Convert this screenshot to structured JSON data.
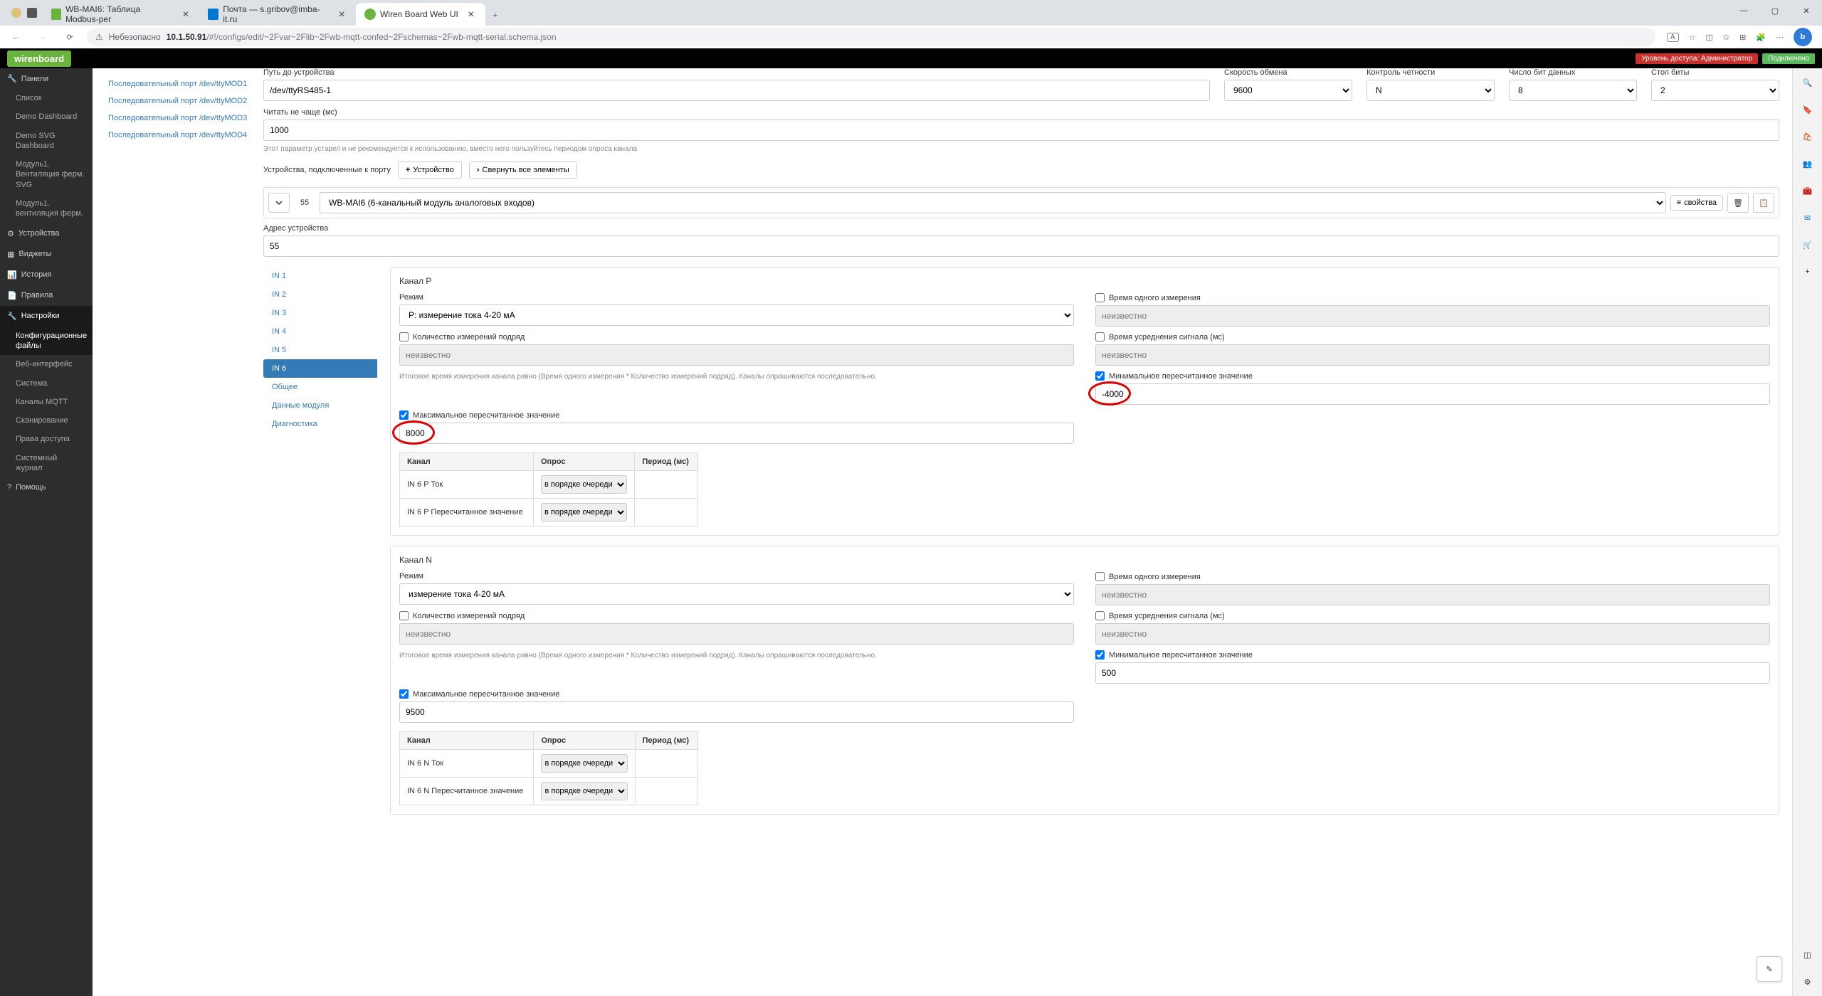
{
  "browser": {
    "tabs": [
      {
        "title": "WB-MAI6: Таблица Modbus-рег",
        "favicon": "#6bb33f"
      },
      {
        "title": "Почта — s.gribov@imba-it.ru",
        "favicon": "#0078d4"
      },
      {
        "title": "Wiren Board Web UI",
        "favicon": "#6bb33f",
        "active": true
      }
    ],
    "insecure_label": "Небезопасно",
    "url_host": "10.1.50.91",
    "url_path": "/#!/configs/edit/~2Fvar~2Flib~2Fwb-mqtt-confed~2Fschemas~2Fwb-mqtt-serial.schema.json",
    "reader_badge": "A"
  },
  "header": {
    "logo": "wirenboard",
    "access_label": "Уровень доступа: Администратор",
    "conn_label": "Подключено"
  },
  "nav": {
    "panels": "Панели",
    "panels_items": [
      "Список",
      "Demo Dashboard",
      "Demo SVG Dashboard",
      "Модуль1. Вентиляция ферм. SVG",
      "Модуль1. вентиляция ферм."
    ],
    "devices": "Устройства",
    "widgets": "Виджеты",
    "history": "История",
    "rules": "Правила",
    "settings": "Настройки",
    "settings_items": [
      "Конфигурационные файлы",
      "Веб-интерфейс",
      "Система",
      "Каналы MQTT",
      "Сканирование",
      "Права доступа",
      "Системный журнал"
    ],
    "help": "Помощь"
  },
  "ports": [
    "Последовательный порт /dev/ttyMOD1",
    "Последовательный порт /dev/ttyMOD2",
    "Последовательный порт /dev/ttyMOD3",
    "Последовательный порт /dev/ttyMOD4"
  ],
  "port_form": {
    "path_label": "Путь до устройства",
    "path_value": "/dev/ttyRS485-1",
    "speed_label": "Скорость обмена",
    "speed_value": "9600",
    "parity_label": "Контроль четности",
    "parity_value": "N",
    "databits_label": "Число бит данных",
    "databits_value": "8",
    "stopbits_label": "Стоп биты",
    "stopbits_value": "2",
    "interval_label": "Читать не чаще (мс)",
    "interval_value": "1000",
    "interval_help": "Этот параметр устарел и не рекомендуется к использованию, вместо него пользуйтесь периодом опроса канала",
    "devices_label": "Устройства, подключенные к порту",
    "add_device": "Устройство",
    "collapse_all": "Свернуть все элементы"
  },
  "device": {
    "addr_prefix": "55",
    "template": "WB-MAI6 (6-канальный модуль аналоговых входов)",
    "properties_btn": "свойства",
    "addr_label": "Адрес устройства",
    "addr_value": "55"
  },
  "tabs": [
    "IN 1",
    "IN 2",
    "IN 3",
    "IN 4",
    "IN 5",
    "IN 6",
    "Общее",
    "Данные модуля",
    "Диагностика"
  ],
  "active_tab": "IN 6",
  "channels": {
    "p": {
      "title": "Канал P",
      "mode_label": "Режим",
      "mode_value": "P: измерение тока 4-20 мА",
      "meas_time_label": "Время одного измерения",
      "meas_count_label": "Количество измерений подряд",
      "avg_time_label": "Время усреднения сигнала (мс)",
      "unknown": "неизвестно",
      "help": "Итоговое время измерения канала равно (Время одного измерения * Количество измерений подряд). Каналы опрашиваются последовательно.",
      "min_recalc_label": "Минимальное пересчитанное значение",
      "min_recalc_value": "-4000",
      "max_recalc_label": "Максимальное пересчитанное значение",
      "max_recalc_value": "8000",
      "table": {
        "headers": [
          "Канал",
          "Опрос",
          "Период (мс)"
        ],
        "rows": [
          {
            "name": "IN 6 P Ток",
            "poll": "в порядке очереди"
          },
          {
            "name": "IN 6 P Пересчитанное значение",
            "poll": "в порядке очереди"
          }
        ]
      }
    },
    "n": {
      "title": "Канал N",
      "mode_label": "Режим",
      "mode_value": "измерение тока 4-20 мА",
      "meas_time_label": "Время одного измерения",
      "meas_count_label": "Количество измерений подряд",
      "avg_time_label": "Время усреднения сигнала (мс)",
      "unknown": "неизвестно",
      "help": "Итоговое время измерения канала равно (Время одного измерения * Количество измерений подряд). Каналы опрашиваются последовательно.",
      "min_recalc_label": "Минимальное пересчитанное значение",
      "min_recalc_value": "500",
      "max_recalc_label": "Максимальное пересчитанное значение",
      "max_recalc_value": "9500",
      "table": {
        "headers": [
          "Канал",
          "Опрос",
          "Период (мс)"
        ],
        "rows": [
          {
            "name": "IN 6 N Ток",
            "poll": "в порядке очереди"
          },
          {
            "name": "IN 6 N Пересчитанное значение",
            "poll": "в порядке очереди"
          }
        ]
      }
    }
  }
}
